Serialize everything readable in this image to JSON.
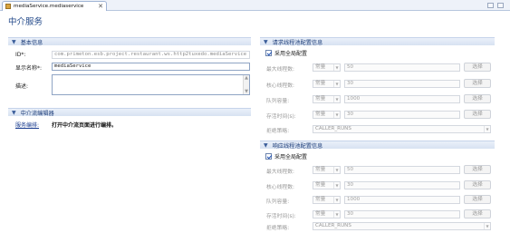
{
  "editor_tab": {
    "label": "mediaService.mediaservice",
    "close": "✕"
  },
  "page_title": "中介服务",
  "basic_info": {
    "header": "基本信息",
    "id_label": "ID*:",
    "id_value": "com.primeton.esb.project.restaurant.ws.http2tuxedo.mediaService",
    "display_name_label": "显示名称*:",
    "display_name_value": "mediaService",
    "description_label": "描述:",
    "description_value": ""
  },
  "mediation_editor": {
    "header": "中介流编辑器",
    "link_text": "服务编排:",
    "hint_text": "打开中介流页面进行编排。"
  },
  "request_pool": {
    "header": "请求线程池配置信息",
    "use_global_label": "采用全局配置",
    "use_global_checked": true,
    "rows": [
      {
        "label": "最大线程数:",
        "mode": "常量",
        "value": "50",
        "button": "选择"
      },
      {
        "label": "核心线程数:",
        "mode": "常量",
        "value": "30",
        "button": "选择"
      },
      {
        "label": "队列容量:",
        "mode": "常量",
        "value": "1000",
        "button": "选择"
      },
      {
        "label": "存活时间(s):",
        "mode": "常量",
        "value": "30",
        "button": "选择"
      }
    ],
    "reject_label": "拒绝策略:",
    "reject_value": "CALLER_RUNS"
  },
  "response_pool": {
    "header": "响应线程池配置信息",
    "use_global_label": "采用全局配置",
    "use_global_checked": true,
    "rows": [
      {
        "label": "最大线程数:",
        "mode": "常量",
        "value": "50",
        "button": "选择"
      },
      {
        "label": "核心线程数:",
        "mode": "常量",
        "value": "30",
        "button": "选择"
      },
      {
        "label": "队列容量:",
        "mode": "常量",
        "value": "1000",
        "button": "选择"
      },
      {
        "label": "存活时间(s):",
        "mode": "常量",
        "value": "30",
        "button": "选择"
      }
    ],
    "reject_label": "拒绝策略:",
    "reject_value": "CALLER_RUNS"
  },
  "icons": [
    "file-icon",
    "close-icon",
    "chevron-down-icon",
    "checkbox-checked-icon",
    "dropdown-arrow-icon",
    "scroll-up-icon",
    "scroll-down-icon"
  ]
}
